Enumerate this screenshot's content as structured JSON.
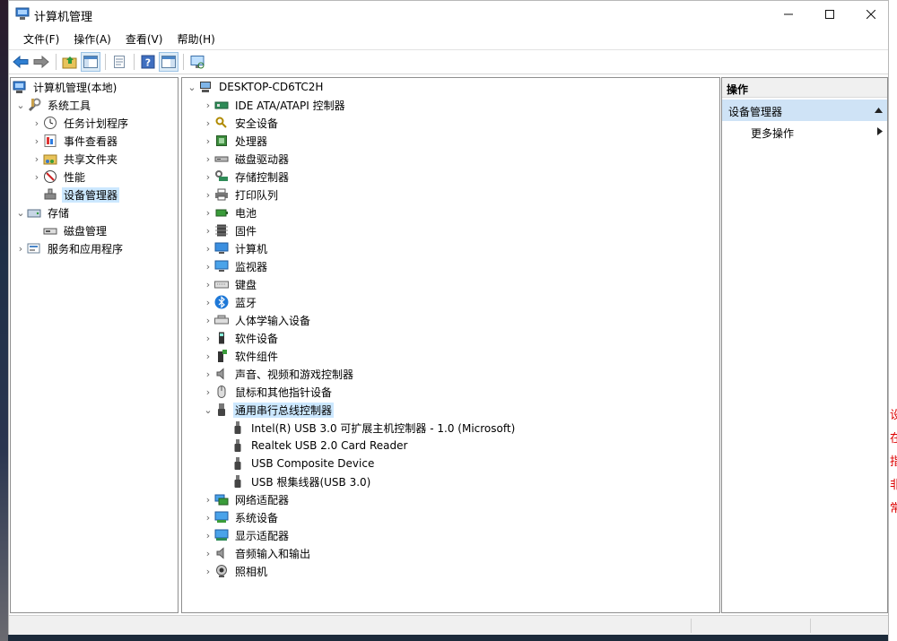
{
  "window": {
    "title": "计算机管理"
  },
  "menu": [
    "文件(F)",
    "操作(A)",
    "查看(V)",
    "帮助(H)"
  ],
  "toolbar": {
    "icons": [
      "back-arrow-icon",
      "forward-arrow-icon",
      "up-folder-icon",
      "show-hide-tree-icon",
      "properties-icon",
      "help-icon",
      "show-action-pane-icon",
      "monitor-scan-icon"
    ]
  },
  "nav_tree": {
    "root": "计算机管理(本地)",
    "system_tools": "系统工具",
    "task_scheduler": "任务计划程序",
    "event_viewer": "事件查看器",
    "shared_folders": "共享文件夹",
    "performance": "性能",
    "device_manager": "设备管理器",
    "storage": "存储",
    "disk_management": "磁盘管理",
    "services_apps": "服务和应用程序"
  },
  "device_tree": {
    "root": "DESKTOP-CD6TC2H",
    "categories": [
      "IDE ATA/ATAPI 控制器",
      "安全设备",
      "处理器",
      "磁盘驱动器",
      "存储控制器",
      "打印队列",
      "电池",
      "固件",
      "计算机",
      "监视器",
      "键盘",
      "蓝牙",
      "人体学输入设备",
      "软件设备",
      "软件组件",
      "声音、视频和游戏控制器",
      "鼠标和其他指针设备",
      "通用串行总线控制器",
      "网络适配器",
      "系统设备",
      "显示适配器",
      "音频输入和输出",
      "照相机"
    ],
    "usb_children": [
      "Intel(R) USB 3.0 可扩展主机控制器 - 1.0 (Microsoft)",
      "Realtek USB 2.0 Card Reader",
      "USB Composite Device",
      "USB 根集线器(USB 3.0)"
    ]
  },
  "actions": {
    "header": "操作",
    "section": "设备管理器",
    "more": "更多操作"
  },
  "desktop_right_text": [
    "设",
    "在",
    "指",
    "非",
    "常"
  ],
  "colors": {
    "selection": "#cce8ff",
    "action_section": "#cfe3f6",
    "pane_border": "#8e8e8e"
  }
}
